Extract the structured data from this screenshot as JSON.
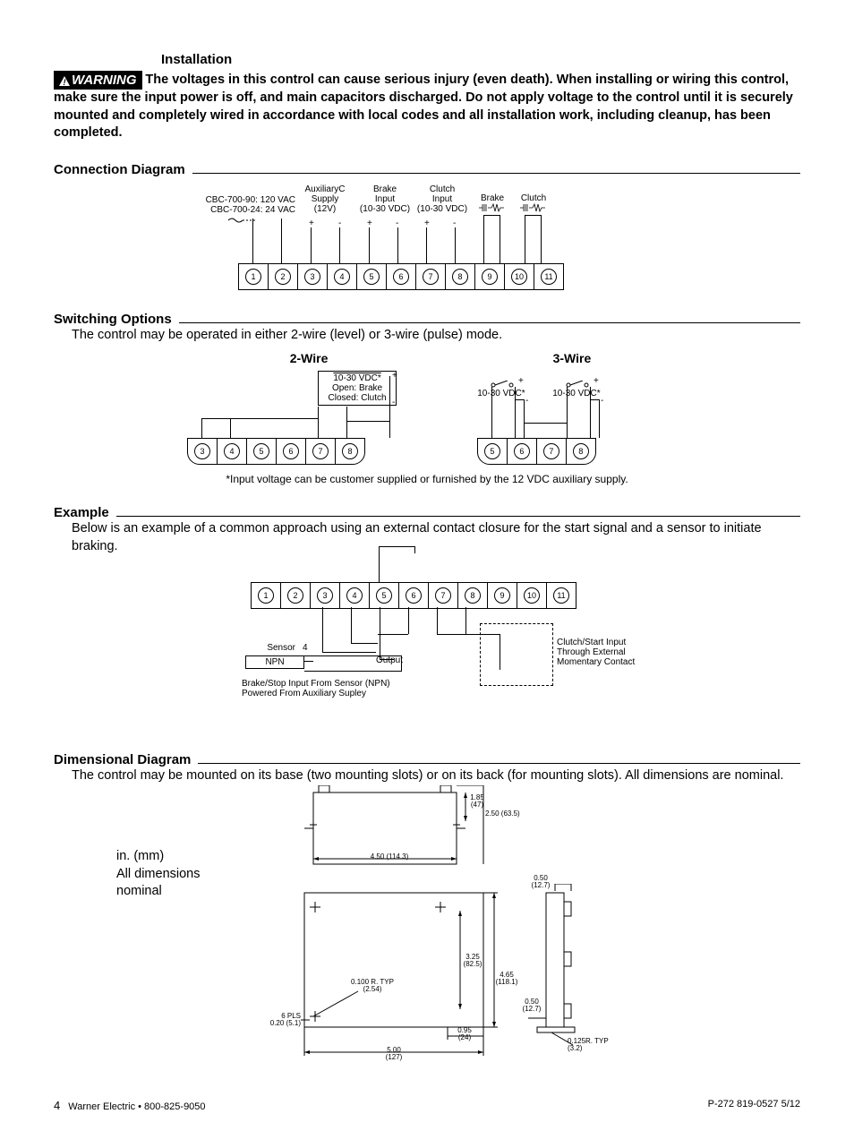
{
  "header": {
    "install_title": "Installation",
    "warning_label": "WARNING",
    "warning_text": "The voltages in this control can cause serious injury (even death). When installing or wiring this control, make sure the input power is off, and main capacitors discharged. Do not apply voltage to the control until it is securely mounted and completely wired in accordance with local codes and all installation work, including cleanup, has been completed."
  },
  "connection": {
    "title": "Connection Diagram",
    "model_line1": "CBC-700-90: 120 VAC",
    "model_line2": "CBC-700-24: 24 VAC",
    "aux_line1": "AuxiliaryC",
    "aux_line2": "Supply",
    "aux_line3": "(12V)",
    "brake_in1": "Brake",
    "brake_in2": "Input",
    "brake_in3": "(10-30 VDC)",
    "clutch_in1": "Clutch",
    "clutch_in2": "Input",
    "clutch_in3": "(10-30 VDC)",
    "brake_out": "Brake",
    "clutch_out": "Clutch",
    "plus": "+",
    "minus": "-",
    "terminals": [
      "1",
      "2",
      "3",
      "4",
      "5",
      "6",
      "7",
      "8",
      "9",
      "10",
      "11"
    ]
  },
  "switching": {
    "title": "Switching Options",
    "intro": "The control may be operated in either 2-wire (level) or 3-wire (pulse) mode.",
    "two_wire_title": "2-Wire",
    "three_wire_title": "3-Wire",
    "two_wire_box_l1": "10-30 VDC*",
    "two_wire_box_l2": "Open: Brake",
    "two_wire_box_l3": "Closed: Clutch",
    "two_wire_plus": "+",
    "two_wire_minus": "-",
    "two_wire_terms": [
      "3",
      "4",
      "5",
      "6",
      "7",
      "8"
    ],
    "three_wire_label_a": "10-30 VDC*",
    "three_wire_label_b": "10-30 VDC*",
    "three_wire_terms": [
      "5",
      "6",
      "7",
      "8"
    ],
    "footnote": "*Input voltage can be customer supplied or furnished by the 12 VDC auxiliary supply."
  },
  "example": {
    "title": "Example",
    "intro": "Below is an example of a common approach using an external contact closure for the start signal and a sensor to initiate braking.",
    "terminals": [
      "1",
      "2",
      "3",
      "4",
      "5",
      "6",
      "7",
      "8",
      "9",
      "10",
      "11"
    ],
    "sensor_label": "Sensor",
    "sensor_4": "4",
    "npn_label": "NPN",
    "output_label": "Output",
    "clutch_line1": "Clutch/Start Input",
    "clutch_line2": "Through External",
    "clutch_line3": "Momentary Contact",
    "brake_note1": "Brake/Stop Input From Sensor (NPN)",
    "brake_note2": "Powered From Auxiliary Supley"
  },
  "dimensional": {
    "title": "Dimensional Diagram",
    "intro": "The control may be mounted on its base (two mounting slots) or on its back (for mounting slots). All dimensions are nominal.",
    "units_l1": "in. (mm)",
    "units_l2": "All dimensions",
    "units_l3": "nominal",
    "d_185": "1.85",
    "d_47": "(47)",
    "d_250": "2.50 (63.5)",
    "d_450": "4.50 (114.3)",
    "d_050a": "0.50",
    "d_127a": "(12.7)",
    "d_325": "3.25",
    "d_825": "(82.5)",
    "d_465": "4.65",
    "d_1181": "(118.1)",
    "d_050b": "0.50",
    "d_127b": "(12.7)",
    "d_0100r": "0.100 R. TYP",
    "d_254": "(2.54)",
    "d_6pls": "6 PLS",
    "d_020": "0.20 (5.1)",
    "d_095": "0.95",
    "d_24": "(24)",
    "d_500": "5.00",
    "d_127c": "(127)",
    "d_0125r": "0.125R.  TYP",
    "d_32": "(3.2)"
  },
  "footer": {
    "page": "4",
    "left": "Warner Electric • 800-825-9050",
    "right": "P-272   819-0527   5/12"
  }
}
